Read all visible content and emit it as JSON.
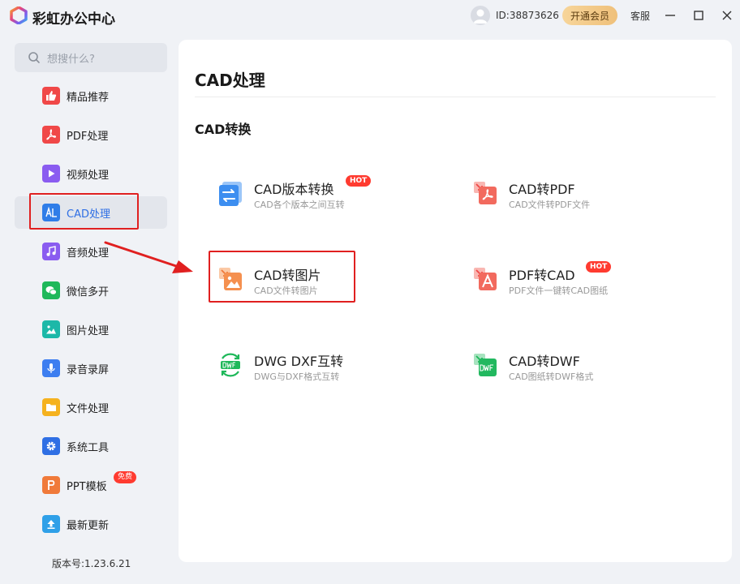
{
  "app": {
    "title": "彩虹办公中心",
    "user_id": "ID:38873626",
    "vip_label": "开通会员",
    "service_label": "客服"
  },
  "sidebar": {
    "search_placeholder": "想搜什么?",
    "items": [
      {
        "label": "精品推荐",
        "icon": "thumbs-up-icon",
        "color": "#f04848"
      },
      {
        "label": "PDF处理",
        "icon": "pdf-icon",
        "color": "#f04848"
      },
      {
        "label": "视频处理",
        "icon": "play-icon",
        "color": "#8a5cf0"
      },
      {
        "label": "CAD处理",
        "icon": "cad-icon",
        "color": "#2f7de8"
      },
      {
        "label": "音频处理",
        "icon": "music-icon",
        "color": "#8a5cf0"
      },
      {
        "label": "微信多开",
        "icon": "wechat-icon",
        "color": "#1fb85a"
      },
      {
        "label": "图片处理",
        "icon": "image-icon",
        "color": "#1cb8a8"
      },
      {
        "label": "录音录屏",
        "icon": "microphone-icon",
        "color": "#3d7ef0"
      },
      {
        "label": "文件处理",
        "icon": "folder-icon",
        "color": "#f5b21f"
      },
      {
        "label": "系统工具",
        "icon": "gear-icon",
        "color": "#2f6fe4"
      },
      {
        "label": "PPT模板",
        "icon": "ppt-icon",
        "color": "#f07a3a",
        "badge": "免费"
      },
      {
        "label": "最新更新",
        "icon": "upload-icon",
        "color": "#2fa0e8"
      }
    ],
    "active_index": 3,
    "version": "版本号:1.23.6.21"
  },
  "main": {
    "title": "CAD处理",
    "section": "CAD转换",
    "tools": [
      {
        "name": "CAD版本转换",
        "desc": "CAD各个版本之间互转",
        "hot": "HOT",
        "icon": "cad-version-convert-icon"
      },
      {
        "name": "CAD转PDF",
        "desc": "CAD文件转PDF文件",
        "icon": "cad-to-pdf-icon"
      },
      {
        "name": "CAD转图片",
        "desc": "CAD文件转图片",
        "icon": "cad-to-image-icon"
      },
      {
        "name": "PDF转CAD",
        "desc": "PDF文件一键转CAD图纸",
        "hot": "HOT",
        "icon": "pdf-to-cad-icon"
      },
      {
        "name": "DWG DXF互转",
        "desc": "DWG与DXF格式互转",
        "icon": "dwg-dxf-convert-icon"
      },
      {
        "name": "CAD转DWF",
        "desc": "CAD图纸转DWF格式",
        "icon": "cad-to-dwf-icon"
      }
    ]
  }
}
